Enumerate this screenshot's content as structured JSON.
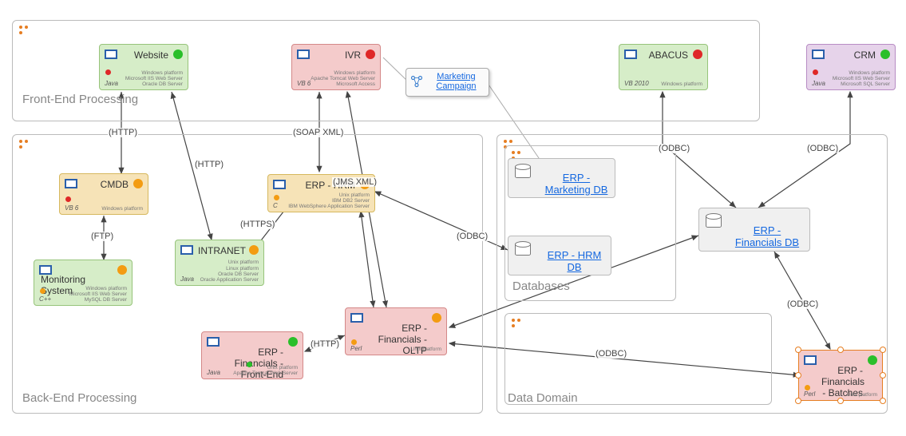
{
  "groups": {
    "frontend": "Front-End Processing",
    "backend": "Back-End Processing",
    "datadomain": "Data Domain",
    "databases": "Databases"
  },
  "external": {
    "marketing": "Marketing Campaign"
  },
  "nodes": {
    "website": {
      "title": "Website",
      "lang": "Java",
      "meta": "Windows platform\nMicrosoft IIS Web Server\nOracle DB Server"
    },
    "ivr": {
      "title": "IVR",
      "lang": "VB 6",
      "meta": "Windows platform\nApache Tomcat Web Server\nMicrosoft Access"
    },
    "abacus": {
      "title": "ABACUS",
      "lang": "VB 2010",
      "meta": "Windows platform"
    },
    "crm": {
      "title": "CRM",
      "lang": "Java",
      "meta": "Windows platform\nMicrosoft IIS Web Server\nMicrosoft SQL Server"
    },
    "cmdb": {
      "title": "CMDB",
      "lang": "VB 6",
      "meta": "Windows platform"
    },
    "monitoring": {
      "title": "Monitoring System",
      "lang": "C++",
      "meta": "Windows platform\nMicrosoft IIS Web Server\nMySQL DB Server"
    },
    "intranet": {
      "title": "INTRANET",
      "lang": "Java",
      "meta": "Unix platform\nLinux platform\nOracle DB Server\nOracle Application Server"
    },
    "erphrm": {
      "title": "ERP - HRM",
      "lang": "C",
      "meta": "Unix platform\nIBM DB2 Server\nIBM WebSphere Application Server"
    },
    "erpfinfe": {
      "title": "ERP - Financials - Front-End",
      "lang": "Java",
      "meta": "Unix platform\nApache Tomcat Web Server"
    },
    "erpfinoltp": {
      "title": "ERP - Financials - OLTP",
      "lang": "Perl",
      "meta": "Unix platform"
    },
    "erpfinbatch": {
      "title": "ERP - Financials - Batches",
      "lang": "Perl",
      "meta": "Unix platform"
    }
  },
  "dbs": {
    "marketing": "ERP - Marketing DB",
    "hrm": "ERP - HRM DB",
    "financials": "ERP - Financials DB"
  },
  "edges": {
    "http1": "(HTTP)",
    "http2": "(HTTP)",
    "http3": "(HTTP)",
    "ftp": "(FTP)",
    "https": "(HTTPS)",
    "soap": "(SOAP XML)",
    "jms": "(JMS XML)",
    "odbc1": "(ODBC)",
    "odbc2": "(ODBC)",
    "odbc3": "(ODBC)",
    "odbc4": "(ODBC)",
    "odbc5": "(ODBC)"
  }
}
